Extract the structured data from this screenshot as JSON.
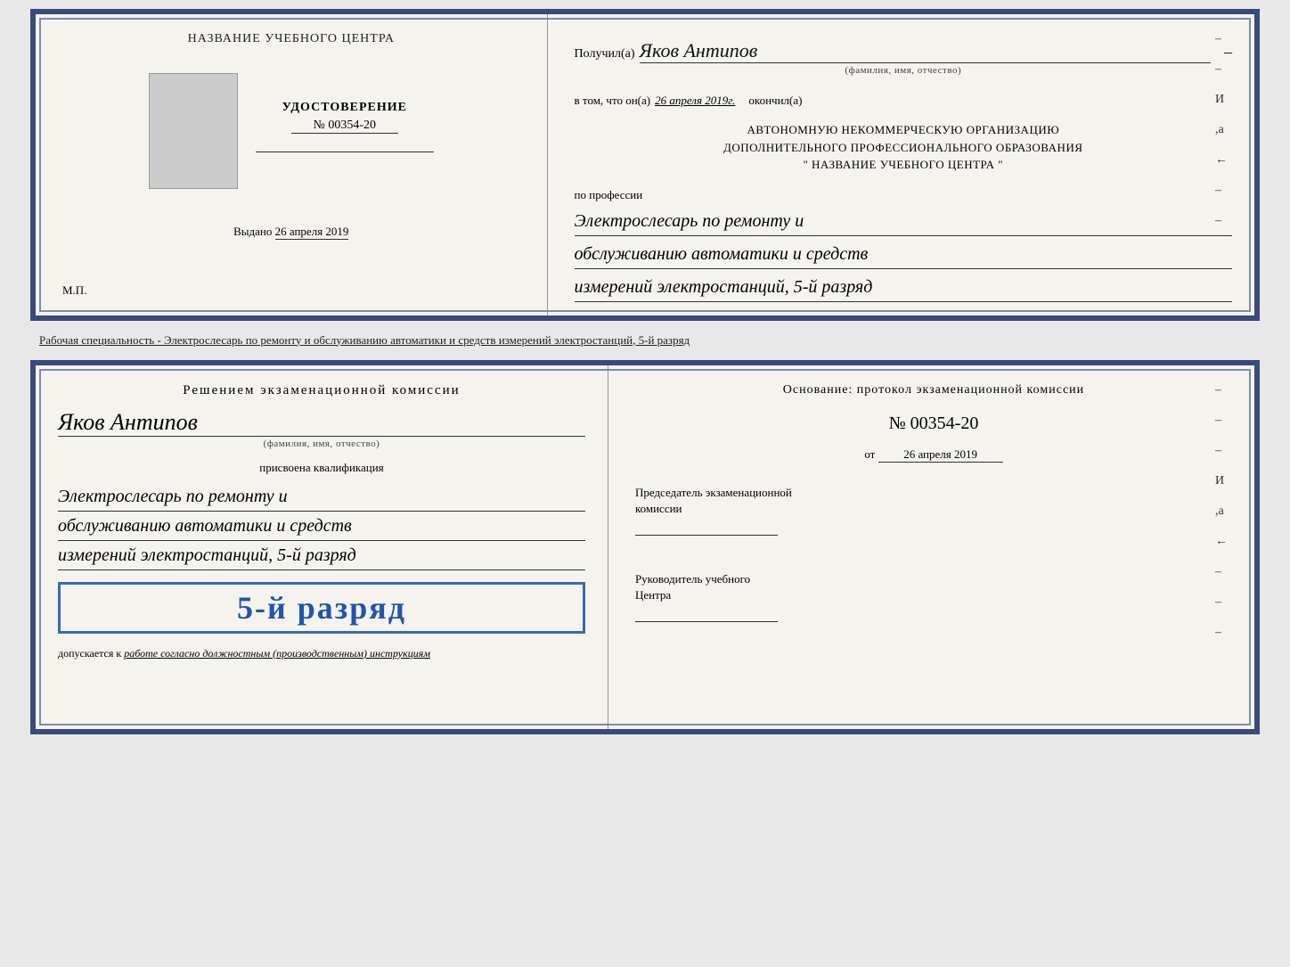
{
  "topCert": {
    "left": {
      "centerTitle": "НАЗВАНИЕ УЧЕБНОГО ЦЕНТРА",
      "udostTitle": "УДОСТОВЕРЕНИЕ",
      "udostNum": "№ 00354-20",
      "vydanoLabel": "Выдано",
      "vydanoDate": "26 апреля 2019",
      "mpLabel": "М.П."
    },
    "right": {
      "poluchilLabel": "Получил(а)",
      "poluchilName": "Яков Антипов",
      "fioHint": "(фамилия, имя, отчество)",
      "vtomLabel": "в том, что он(а)",
      "vtomDate": "26 апреля 2019г.",
      "okonchilLabel": "окончил(а)",
      "orgLine1": "АВТОНОМНУЮ НЕКОММЕРЧЕСКУЮ ОРГАНИЗАЦИЮ",
      "orgLine2": "ДОПОЛНИТЕЛЬНОГО ПРОФЕССИОНАЛЬНОГО ОБРАЗОВАНИЯ",
      "orgLine3": "\"   НАЗВАНИЕ УЧЕБНОГО ЦЕНТРА   \"",
      "professionLabel": "по профессии",
      "professionLine1": "Электрослесарь по ремонту и",
      "professionLine2": "обслуживанию автоматики и средств",
      "professionLine3": "измерений электростанций, 5-й разряд",
      "verticalLabel": "И а ←"
    }
  },
  "separatorText": "Рабочая специальность - Электрослесарь по ремонту и обслуживанию автоматики и средств измерений электростанций, 5-й разряд",
  "bottomCert": {
    "left": {
      "resheniemTitle": "Решением экзаменационной комиссии",
      "personName": "Яков Антипов",
      "fioHint": "(фамилия, имя, отчество)",
      "prisvoenaLabel": "присвоена квалификация",
      "qualLine1": "Электрослесарь по ремонту и",
      "qualLine2": "обслуживанию автоматики и средств",
      "qualLine3": "измерений электростанций, 5-й разряд",
      "razryadBadge": "5-й разряд",
      "dopuskaetsyaLabel": "допускается к",
      "dopuskaetsyaText": "работе согласно должностным (производственным) инструкциям"
    },
    "right": {
      "osnovanieTitleLine1": "Основание: протокол экзаменационной комиссии",
      "protocolNum": "№  00354-20",
      "otLabel": "от",
      "otDate": "26 апреля 2019",
      "predsedatelLabel": "Председатель экзаменационной",
      "predsedatelLabel2": "комиссии",
      "rukovoditelLabel": "Руководитель учебного",
      "rukovoditelLabel2": "Центра",
      "verticalLabel": "И а ←"
    }
  }
}
